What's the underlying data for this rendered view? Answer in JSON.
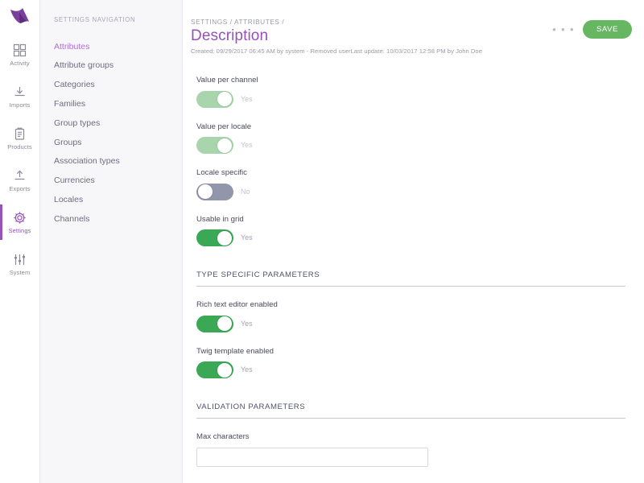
{
  "brand": {
    "logo_name": "akeneo-logo",
    "accent_purple": "#9452ba",
    "accent_green": "#3aa855"
  },
  "icon_rail": {
    "items": [
      {
        "label": "Activity",
        "icon": "grid-icon",
        "active": false
      },
      {
        "label": "Imports",
        "icon": "import-arrow-icon",
        "active": false
      },
      {
        "label": "Products",
        "icon": "clipboard-icon",
        "active": false
      },
      {
        "label": "Exports",
        "icon": "export-arrow-icon",
        "active": false
      },
      {
        "label": "Settings",
        "icon": "gear-icon",
        "active": true
      },
      {
        "label": "System",
        "icon": "sliders-icon",
        "active": false
      }
    ]
  },
  "nav_panel": {
    "title": "SETTINGS NAVIGATION",
    "items": [
      {
        "label": "Attributes",
        "active": true
      },
      {
        "label": "Attribute groups",
        "active": false
      },
      {
        "label": "Categories",
        "active": false
      },
      {
        "label": "Families",
        "active": false
      },
      {
        "label": "Group types",
        "active": false
      },
      {
        "label": "Groups",
        "active": false
      },
      {
        "label": "Association types",
        "active": false
      },
      {
        "label": "Currencies",
        "active": false
      },
      {
        "label": "Locales",
        "active": false
      },
      {
        "label": "Channels",
        "active": false
      }
    ]
  },
  "header": {
    "breadcrumb": "SETTINGS / ATTRIBUTES /",
    "title": "Description",
    "meta": "Created: 09/29/2017 06:45 AM by system - Removed userLast update: 10/03/2017 12:58 PM by John Doe",
    "more_label": "• • •",
    "save_label": "SAVE"
  },
  "fields": [
    {
      "label": "Value per channel",
      "state": "on-muted",
      "value": "Yes",
      "value_muted": true
    },
    {
      "label": "Value per locale",
      "state": "on-muted",
      "value": "Yes",
      "value_muted": true
    },
    {
      "label": "Locale specific",
      "state": "off",
      "value": "No",
      "value_muted": true
    },
    {
      "label": "Usable in grid",
      "state": "on",
      "value": "Yes",
      "value_muted": false
    }
  ],
  "type_section": {
    "title": "TYPE SPECIFIC PARAMETERS",
    "fields": [
      {
        "label": "Rich text editor enabled",
        "state": "on",
        "value": "Yes"
      },
      {
        "label": "Twig template enabled",
        "state": "on",
        "value": "Yes"
      }
    ]
  },
  "validation_section": {
    "title": "VALIDATION PARAMETERS",
    "max_characters_label": "Max characters",
    "max_characters_value": "",
    "max_characters_placeholder": ""
  }
}
